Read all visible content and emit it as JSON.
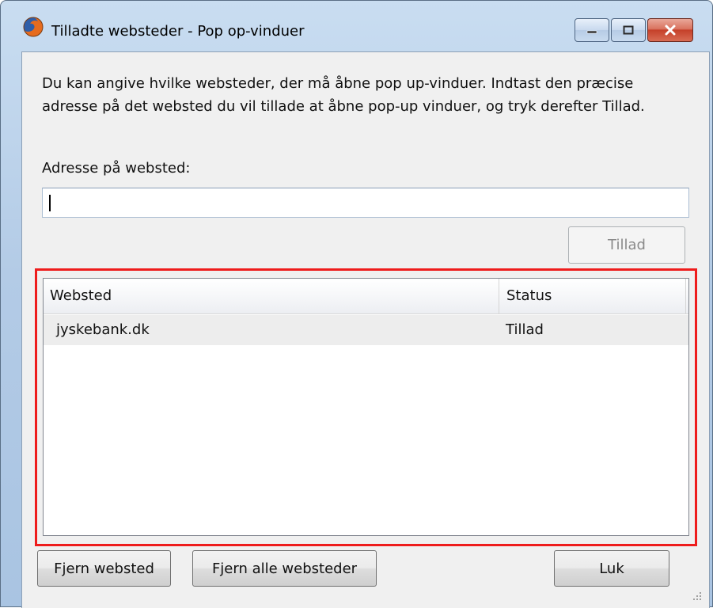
{
  "window": {
    "title": "Tilladte websteder - Pop op-vinduer"
  },
  "description": "Du kan angive hvilke websteder, der må åbne pop up-vinduer. Indtast den præcise adresse på det websted du vil tillade at åbne pop-up vinduer, og tryk derefter Tillad.",
  "address": {
    "label": "Adresse på websted:",
    "value": ""
  },
  "allow_button": "Tillad",
  "site_list": {
    "columns": [
      "Websted",
      "Status"
    ],
    "rows": [
      {
        "site": "jyskebank.dk",
        "status": "Tillad"
      }
    ]
  },
  "buttons": {
    "remove": "Fjern websted",
    "remove_all": "Fjern alle websteder",
    "close": "Luk"
  },
  "colors": {
    "highlight_frame": "#ee1c1c",
    "close_button": "#c5402a"
  },
  "icons": {
    "app": "firefox-icon",
    "minimize": "minimize-icon",
    "maximize": "maximize-icon",
    "close": "close-icon"
  }
}
